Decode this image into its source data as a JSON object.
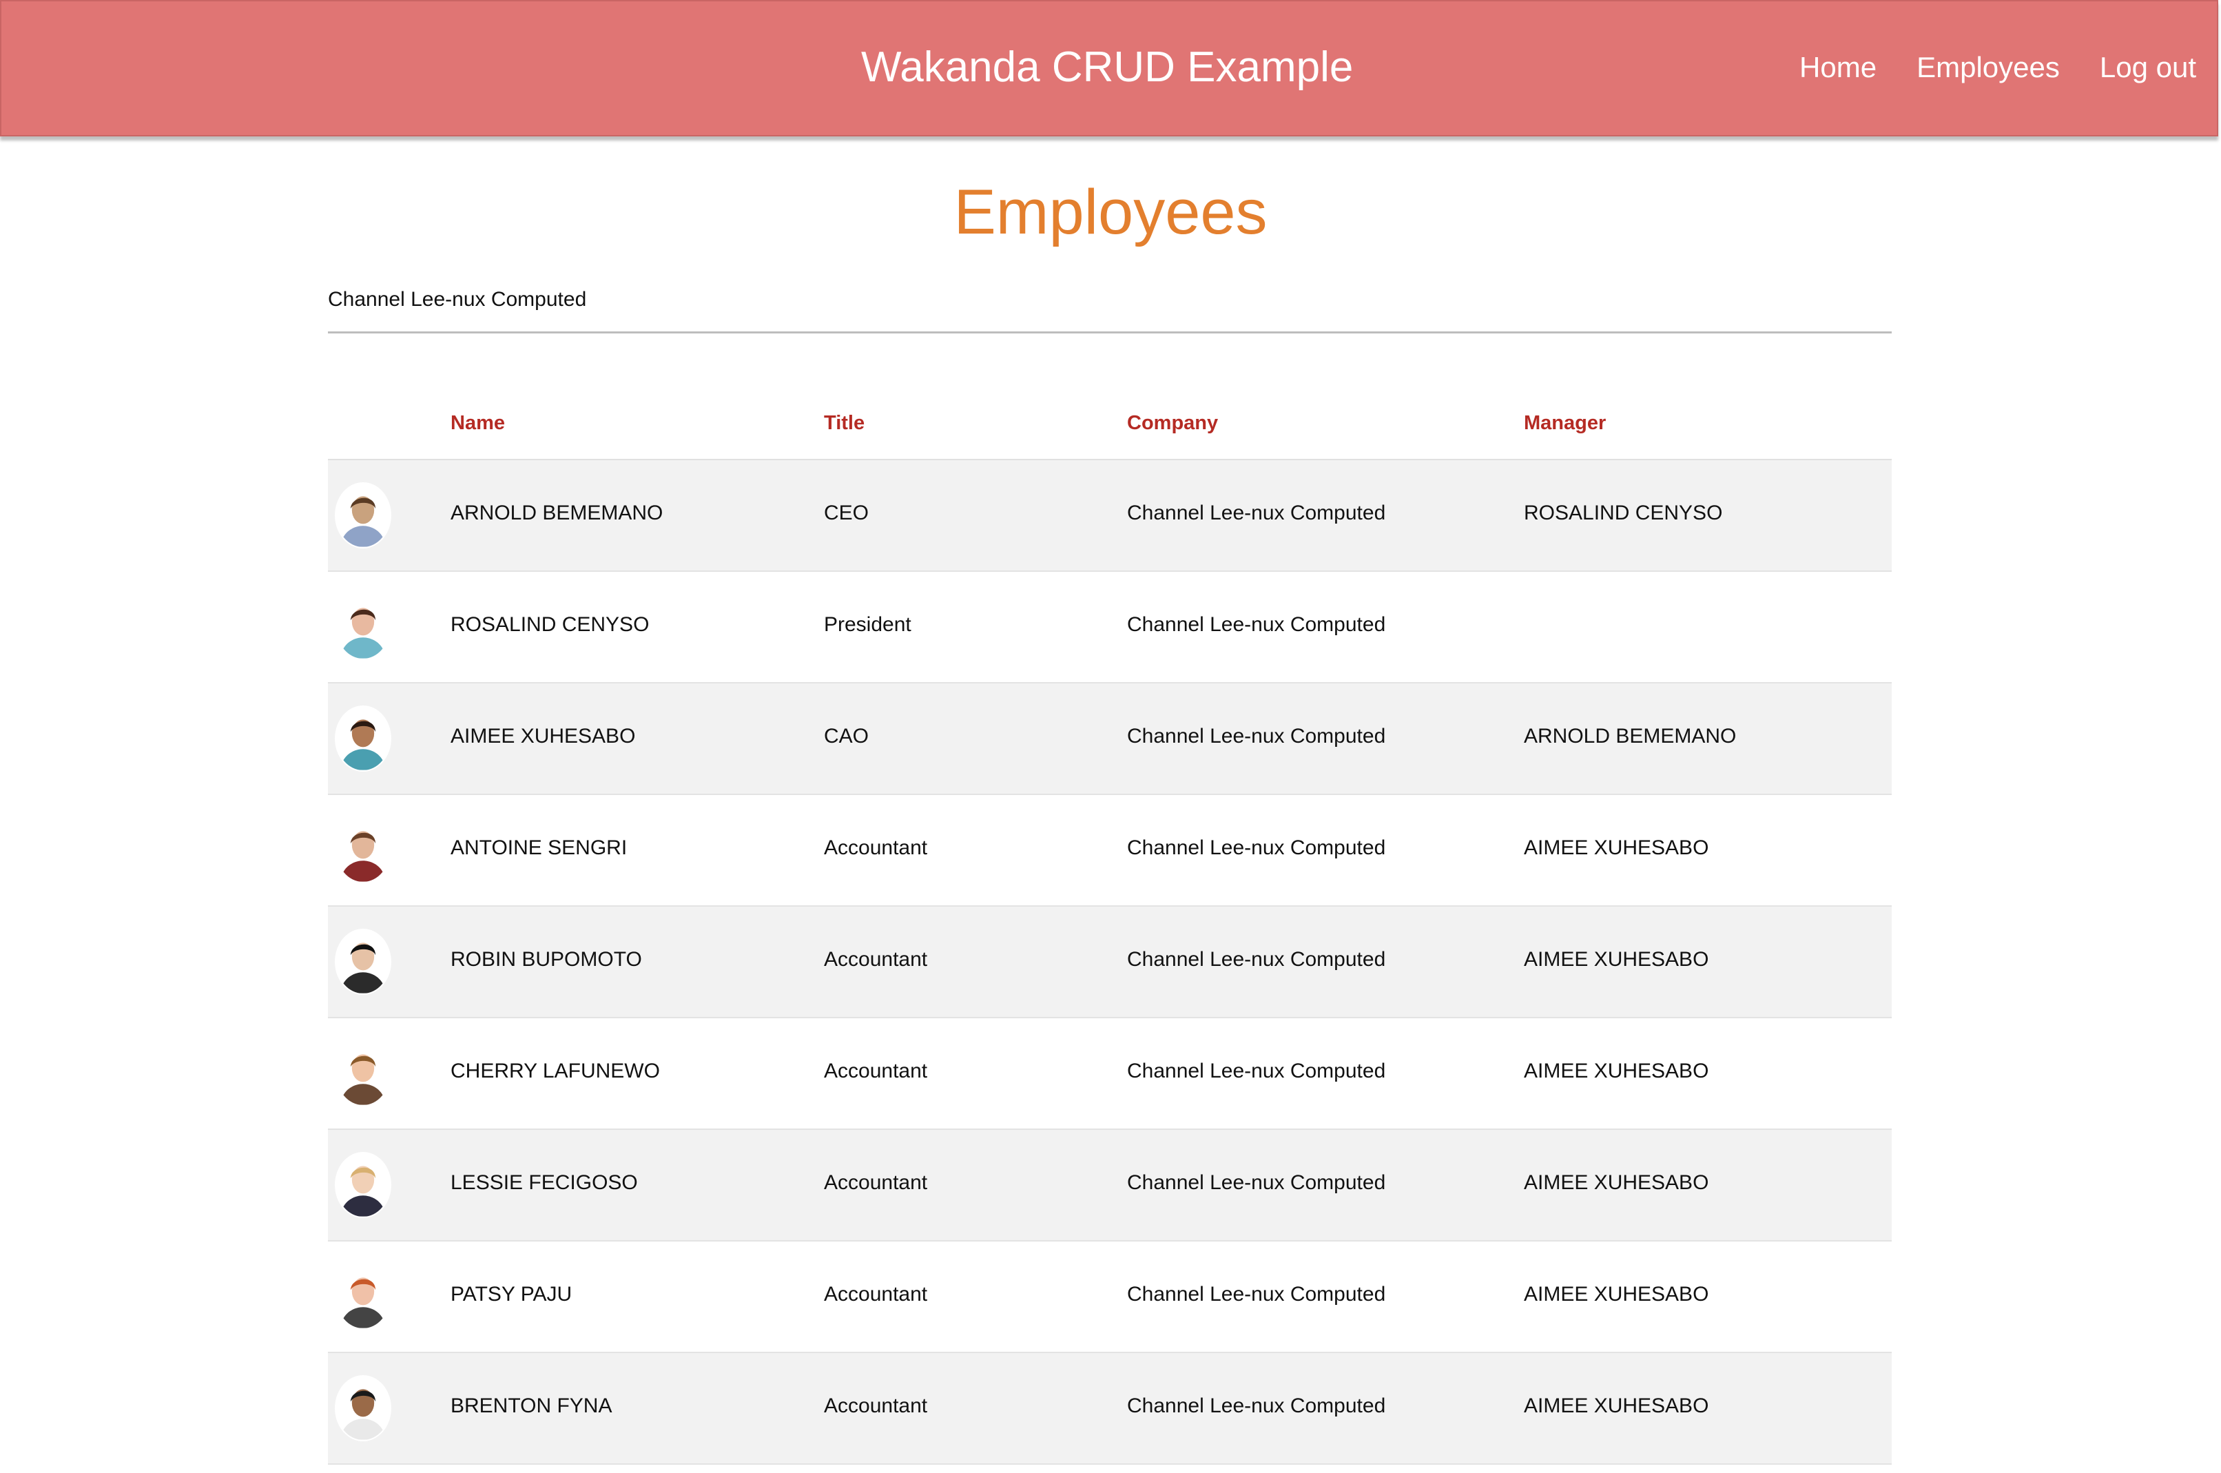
{
  "header": {
    "app_title": "Wakanda CRUD Example",
    "nav": [
      {
        "label": "Home"
      },
      {
        "label": "Employees"
      },
      {
        "label": "Log out"
      }
    ]
  },
  "page": {
    "title": "Employees",
    "company_filter": "Channel Lee-nux Computed"
  },
  "table": {
    "columns": {
      "name": "Name",
      "title": "Title",
      "company": "Company",
      "manager": "Manager"
    },
    "rows": [
      {
        "name": "ARNOLD BEMEMANO",
        "title": "CEO",
        "company": "Channel Lee-nux Computed",
        "manager": "ROSALIND CENYSO",
        "avatar": "avatar-photo"
      },
      {
        "name": "ROSALIND CENYSO",
        "title": "President",
        "company": "Channel Lee-nux Computed",
        "manager": "",
        "avatar": "avatar-photo"
      },
      {
        "name": "AIMEE XUHESABO",
        "title": "CAO",
        "company": "Channel Lee-nux Computed",
        "manager": "ARNOLD BEMEMANO",
        "avatar": "avatar-photo"
      },
      {
        "name": "ANTOINE SENGRI",
        "title": "Accountant",
        "company": "Channel Lee-nux Computed",
        "manager": "AIMEE XUHESABO",
        "avatar": "avatar-photo"
      },
      {
        "name": "ROBIN BUPOMOTO",
        "title": "Accountant",
        "company": "Channel Lee-nux Computed",
        "manager": "AIMEE XUHESABO",
        "avatar": "avatar-photo"
      },
      {
        "name": "CHERRY LAFUNEWO",
        "title": "Accountant",
        "company": "Channel Lee-nux Computed",
        "manager": "AIMEE XUHESABO",
        "avatar": "avatar-photo"
      },
      {
        "name": "LESSIE FECIGOSO",
        "title": "Accountant",
        "company": "Channel Lee-nux Computed",
        "manager": "AIMEE XUHESABO",
        "avatar": "avatar-photo"
      },
      {
        "name": "PATSY PAJU",
        "title": "Accountant",
        "company": "Channel Lee-nux Computed",
        "manager": "AIMEE XUHESABO",
        "avatar": "avatar-photo"
      },
      {
        "name": "BRENTON FYNA",
        "title": "Accountant",
        "company": "Channel Lee-nux Computed",
        "manager": "AIMEE XUHESABO",
        "avatar": "avatar-photo"
      }
    ]
  },
  "colors": {
    "header_bg": "#e07574",
    "page_title": "#e37f2e",
    "column_header": "#b52b24",
    "row_alt": "#f2f2f2"
  }
}
